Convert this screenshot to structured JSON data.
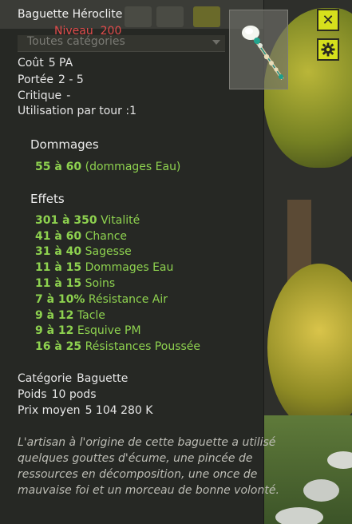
{
  "item": {
    "title": "Baguette Héroclite",
    "level_label": "Niveau",
    "level_value": "200"
  },
  "background_filter": {
    "placeholder": "Toutes catégories"
  },
  "stats": {
    "cost": {
      "label": "Coût",
      "value": "5 PA"
    },
    "range": {
      "label": "Portée",
      "value": "2 - 5"
    },
    "critical": {
      "label": "Critique",
      "value": "-"
    },
    "uses": {
      "label": "Utilisation par tour :",
      "value": "1"
    }
  },
  "damage": {
    "header": "Dommages",
    "lines": [
      {
        "range": "55 à 60",
        "label": "(dommages Eau)"
      }
    ]
  },
  "effects": {
    "header": "Effets",
    "lines": [
      {
        "range": "301 à 350",
        "label": "Vitalité"
      },
      {
        "range": "41 à 60",
        "label": "Chance"
      },
      {
        "range": "31 à 40",
        "label": "Sagesse"
      },
      {
        "range": "11 à 15",
        "label": "Dommages Eau"
      },
      {
        "range": "11 à 15",
        "label": "Soins"
      },
      {
        "range": "7 à 10%",
        "label": "Résistance Air"
      },
      {
        "range": "9 à 12",
        "label": "Tacle"
      },
      {
        "range": "9 à 12",
        "label": "Esquive PM"
      },
      {
        "range": "16 à 25",
        "label": "Résistances Poussée"
      }
    ]
  },
  "info": {
    "category": {
      "label": "Catégorie",
      "value": "Baguette"
    },
    "weight": {
      "label": "Poids",
      "value": "10 pods"
    },
    "price": {
      "label": "Prix moyen",
      "value": "5 104 280 K"
    }
  },
  "description": "L'artisan à l'origine de cette baguette a utilisé quelques gouttes d'écume, une pincée de ressources en décomposition, une once de mauvaise foi et un morceau de bonne volonté.",
  "buttons": {
    "close": "✕"
  },
  "icons": {
    "close": "close-icon",
    "settings": "gear-icon",
    "item": "wand-icon"
  },
  "colors": {
    "level": "#e14b4b",
    "effect": "#8ed24f",
    "button": "#d6e01c"
  }
}
